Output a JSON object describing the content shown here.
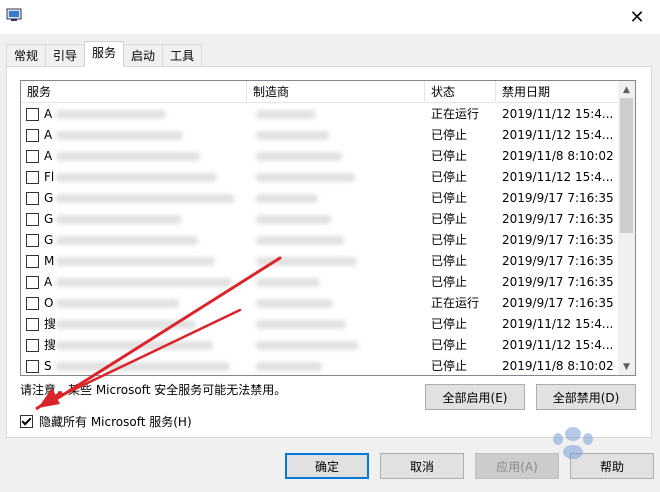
{
  "tabs": [
    "常规",
    "引导",
    "服务",
    "启动",
    "工具"
  ],
  "active_tab": 2,
  "columns": [
    "服务",
    "制造商",
    "状态",
    "禁用日期"
  ],
  "rows": [
    {
      "first": "A",
      "status": "正在运行",
      "date": "2019/11/12 15:4..."
    },
    {
      "first": "A",
      "status": "已停止",
      "date": "2019/11/12 15:4..."
    },
    {
      "first": "A",
      "status": "已停止",
      "date": "2019/11/8 8:10:02"
    },
    {
      "first": "Fl",
      "status": "已停止",
      "date": "2019/11/12 15:4..."
    },
    {
      "first": "G",
      "status": "已停止",
      "date": "2019/9/17 7:16:35"
    },
    {
      "first": "G",
      "status": "已停止",
      "date": "2019/9/17 7:16:35"
    },
    {
      "first": "G",
      "status": "已停止",
      "date": "2019/9/17 7:16:35"
    },
    {
      "first": "M",
      "status": "已停止",
      "date": "2019/9/17 7:16:35"
    },
    {
      "first": "A",
      "status": "已停止",
      "date": "2019/9/17 7:16:35"
    },
    {
      "first": "O",
      "status": "正在运行",
      "date": "2019/9/17 7:16:35"
    },
    {
      "first": "搜",
      "status": "已停止",
      "date": "2019/11/12 15:4..."
    },
    {
      "first": "搜",
      "status": "已停止",
      "date": "2019/11/12 15:4..."
    },
    {
      "first": "S",
      "status": "已停止",
      "date": "2019/11/8 8:10:02"
    }
  ],
  "note": "请注意，某些 Microsoft 安全服务可能无法禁用。",
  "enable_all": "全部启用(E)",
  "disable_all": "全部禁用(D)",
  "hide_ms_label": "隐藏所有 Microsoft 服务(H)",
  "hide_ms_checked": true,
  "buttons": {
    "ok": "确定",
    "cancel": "取消",
    "apply": "应用(A)",
    "help": "帮助"
  },
  "colors": {
    "arrow": "#d9252a",
    "accent": "#0078d7"
  },
  "icons": {
    "close": "close-icon",
    "window": "msconfig-icon"
  }
}
